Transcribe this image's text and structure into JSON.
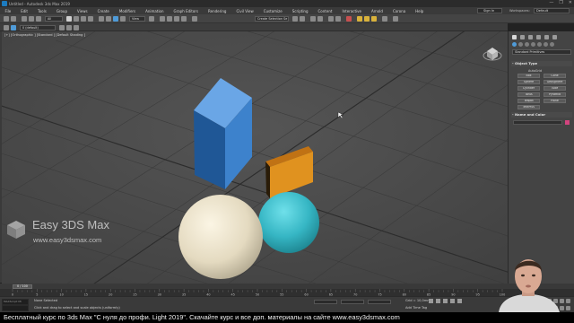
{
  "window": {
    "title": "Untitled - Autodesk 3ds Max 2019",
    "controls": [
      "—",
      "❐",
      "✕"
    ]
  },
  "menu": {
    "items": [
      "File",
      "Edit",
      "Tools",
      "Group",
      "Views",
      "Create",
      "Modifiers",
      "Animation",
      "Graph Editors",
      "Rendering",
      "Civil View",
      "Customize",
      "Scripting",
      "Content",
      "Interactive",
      "Arnold",
      "Corona",
      "Help"
    ],
    "sign_in": "Sign In",
    "workspaces_label": "Workspaces:",
    "workspace_value": "Default"
  },
  "toolbar": {
    "selection_filter": "All",
    "reference_coord": "View",
    "named_selection": "Create Selection Se",
    "layer_dropdown": "0 (default)"
  },
  "viewport": {
    "label": "[+] [Orthographic ] [Standard ] [Default Shading ]"
  },
  "watermark": {
    "title": "Easy 3DS Max",
    "url": "www.easy3dsmax.com"
  },
  "command_panel": {
    "category_dropdown": "Standard Primitives",
    "object_type_rollout": "Object Type",
    "autogrid_label": "AutoGrid",
    "buttons": [
      "Box",
      "Cone",
      "Sphere",
      "GeoSphere",
      "Cylinder",
      "Tube",
      "Torus",
      "Pyramid",
      "Teapot",
      "Plane",
      "TextPlus"
    ],
    "name_color_rollout": "Name and Color",
    "object_color": "#d2447e"
  },
  "timeline": {
    "frame_label": "0 / 100",
    "tick_labels": [
      "0",
      "5",
      "10",
      "15",
      "20",
      "25",
      "30",
      "35",
      "40",
      "45",
      "50",
      "55",
      "60",
      "65",
      "70",
      "75",
      "80",
      "85",
      "90",
      "95",
      "100"
    ]
  },
  "status": {
    "maxscript_label": "MAXScript Mi",
    "selection_text": "None Selected",
    "prompt_text": "Click and drag to select and scale objects (uniformly)",
    "grid_text": "Grid = 10,0mm",
    "add_time_tag": "Add Time Tag"
  },
  "subtitle": {
    "text": "Бесплатный курс по 3ds Max \"С нуля до профи. Light 2019\". Скачайте курс и все доп. материалы на сайте www.easy3dsmax.com"
  },
  "colors": {
    "box": "#3d82cc",
    "plane": "#d9861f",
    "teal_sphere": "#36b6c4",
    "cream_sphere": "#e8dfc6"
  }
}
